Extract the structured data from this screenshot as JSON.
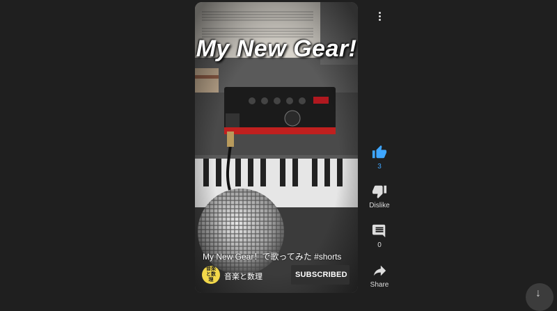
{
  "video": {
    "overlay_title": "My New Gear!",
    "caption": "My New Gear！で歌ってみた #shorts",
    "channel": {
      "name": "音楽と数理",
      "avatar_text": "音楽と数理",
      "subscribe_label": "SUBSCRIBED"
    }
  },
  "actions": {
    "like": {
      "icon": "thumb-up-icon",
      "label": "3",
      "color": "#3ea6ff"
    },
    "dislike": {
      "icon": "thumb-down-icon",
      "label": "Dislike"
    },
    "comment": {
      "icon": "comment-icon",
      "label": "0"
    },
    "share": {
      "icon": "share-icon",
      "label": "Share"
    }
  },
  "colors": {
    "background": "#1f1f1f",
    "accent": "#3ea6ff",
    "button_bg": "#303030"
  }
}
